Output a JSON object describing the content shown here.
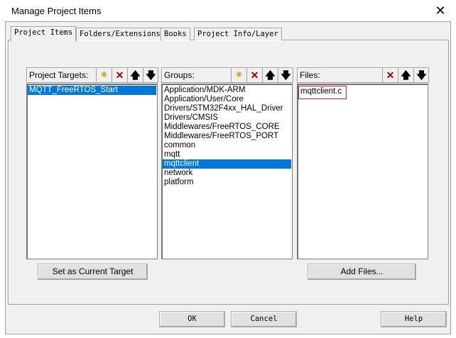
{
  "window": {
    "title": "Manage Project Items",
    "close": "✕"
  },
  "tabs": [
    "Project Items",
    "Folders/Extensions",
    "Books",
    "Project Info/Layer"
  ],
  "targets": {
    "label": "Project Targets:",
    "items": [
      "MQTT_FreeRTOS_Start"
    ],
    "selected": 0,
    "button": "Set as Current Target"
  },
  "groups": {
    "label": "Groups:",
    "items": [
      "Application/MDK-ARM",
      "Application/User/Core",
      "Drivers/STM32F4xx_HAL_Driver",
      "Drivers/CMSIS",
      "Middlewares/FreeRTOS_CORE",
      "Middlewares/FreeRTOS_PORT",
      "common",
      "mqtt",
      "mqttclient",
      "network",
      "platform"
    ],
    "selected": 8
  },
  "files": {
    "label": "Files:",
    "items": [
      "mqttclient.c"
    ],
    "button": "Add Files..."
  },
  "icons": {
    "new": "✳",
    "delete": "✕",
    "up": "🡅",
    "down": "🡇"
  },
  "footer": {
    "ok": "OK",
    "cancel": "Cancel",
    "help": "Help"
  }
}
